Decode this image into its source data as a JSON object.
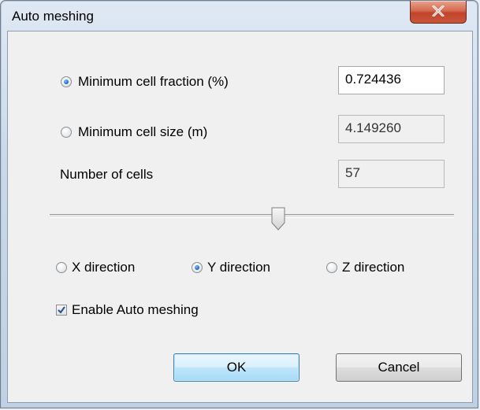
{
  "window": {
    "title": "Auto meshing",
    "close_glyph": "X"
  },
  "options": {
    "min_cell_fraction": {
      "label": "Minimum cell fraction (%)",
      "value": "0.724436",
      "selected": true
    },
    "min_cell_size": {
      "label": "Minimum cell size (m)",
      "value": "4.149260",
      "selected": false
    },
    "num_cells": {
      "label": "Number of cells",
      "value": "57"
    }
  },
  "slider": {
    "level_fraction": 0.58
  },
  "directions": {
    "x": {
      "label": "X direction",
      "selected": false
    },
    "y": {
      "label": "Y direction",
      "selected": true
    },
    "z": {
      "label": "Z direction",
      "selected": false
    }
  },
  "enable_auto_meshing": {
    "label": "Enable Auto meshing",
    "checked": true
  },
  "buttons": {
    "ok": "OK",
    "cancel": "Cancel"
  },
  "colors": {
    "accent_blue": "#1f6fd1",
    "close_red": "#c1432a",
    "default_button_border": "#3c7fb1"
  }
}
